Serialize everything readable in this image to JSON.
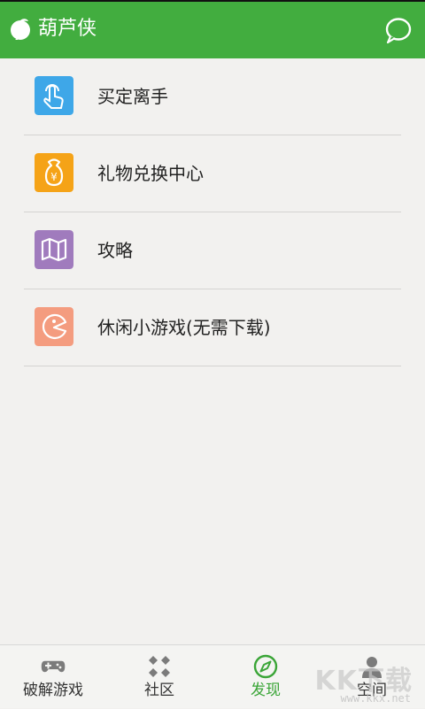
{
  "header": {
    "title": "葫芦侠",
    "logo_icon": "gourd-logo-icon",
    "chat_icon": "chat-bubble-icon"
  },
  "discover": {
    "items": [
      {
        "label": "买定离手",
        "icon": "touch-hand-icon",
        "color": "#3ea7e8"
      },
      {
        "label": "礼物兑换中心",
        "icon": "gift-bag-icon",
        "color": "#f5a317"
      },
      {
        "label": "攻略",
        "icon": "map-icon",
        "color": "#a07bbd"
      },
      {
        "label": "休闲小游戏(无需下载)",
        "icon": "pacman-icon",
        "color": "#f49c7f"
      }
    ]
  },
  "bottom_nav": {
    "tabs": [
      {
        "label": "破解游戏",
        "icon": "gamepad-icon",
        "active": false
      },
      {
        "label": "社区",
        "icon": "grid-icon",
        "active": false
      },
      {
        "label": "发现",
        "icon": "compass-icon",
        "active": true
      },
      {
        "label": "空间",
        "icon": "person-icon",
        "active": false
      }
    ]
  },
  "watermark": {
    "brand": "KK下载",
    "url": "www.kkx.net"
  },
  "colors": {
    "primary": "#42ad3f",
    "background": "#f2f1ef",
    "active_tab": "#3aa537"
  }
}
